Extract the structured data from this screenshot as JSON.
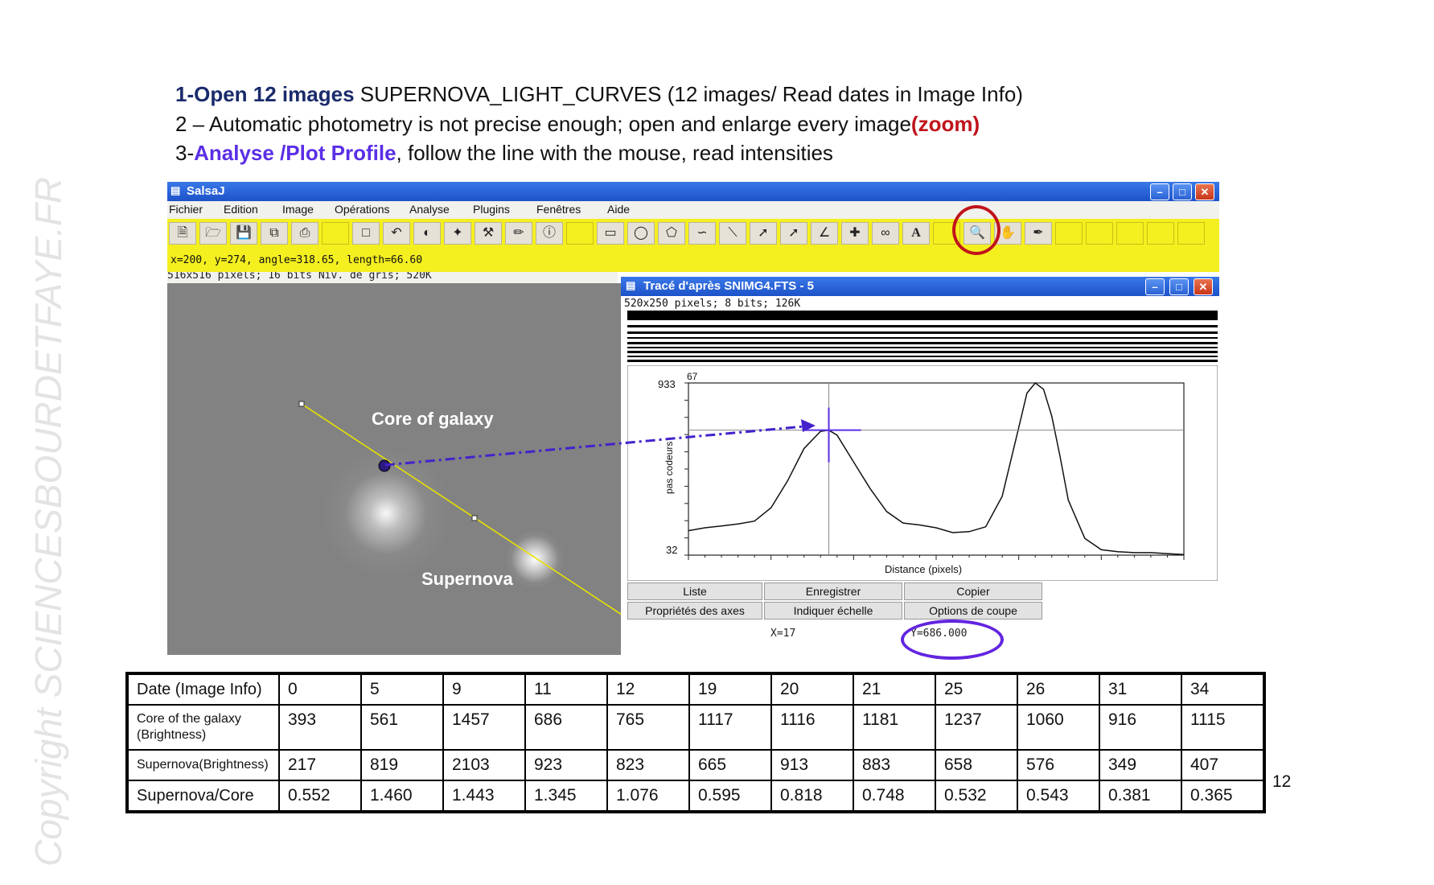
{
  "watermark": "Copyright SCIENCESBOURDETFAYE.FR",
  "instructions": {
    "line1_bold": "1-Open 12 images",
    "line1_rest": " SUPERNOVA_LIGHT_CURVES (12 images/ Read dates in Image Info)",
    "line2_rest": "2 – Automatic photometry is not precise enough; open and enlarge every image",
    "line2_red": "(zoom)",
    "line3_prefix": "3-",
    "line3_purple": "Analyse /Plot Profile",
    "line3_rest": ",  follow the line with the mouse, read intensities"
  },
  "salsaj": {
    "title": "SalsaJ",
    "menus": [
      "Fichier",
      "Edition",
      "Image",
      "Opérations",
      "Analyse",
      "Plugins",
      "Fenêtres",
      "Aide"
    ],
    "status": "x=200, y=274, angle=318.65, length=66.60",
    "image_info": "516x516 pixels; 16 bits Niv. de gris; 520K",
    "label_core": "Core of galaxy",
    "label_supernova": "Supernova"
  },
  "profile": {
    "title": "Tracé d'après SNIMG4.FTS - 5",
    "info": "520x250 pixels; 8 bits; 126K",
    "y_top": "933",
    "y_top_extra": "67",
    "y_bottom": "32",
    "ylabel": "pas codeurs",
    "xlabel": "Distance (pixels)",
    "buttons": [
      "Liste",
      "Enregistrer",
      "Copier",
      "Propriétés des axes",
      "Indiquer échelle",
      "Options de coupe"
    ],
    "x_readout": "X=17",
    "y_readout": "Y=686.000"
  },
  "chart_data": {
    "type": "line",
    "x": [
      0,
      2,
      4,
      6,
      8,
      10,
      12,
      14,
      16,
      17,
      18,
      20,
      22,
      24,
      26,
      28,
      30,
      32,
      34,
      36,
      38,
      40,
      41,
      42,
      43,
      44,
      45,
      46,
      48,
      50,
      52,
      54,
      56,
      58,
      60
    ],
    "values": [
      160,
      175,
      185,
      195,
      210,
      280,
      420,
      590,
      680,
      686,
      660,
      520,
      380,
      260,
      200,
      190,
      175,
      150,
      155,
      180,
      340,
      700,
      880,
      933,
      900,
      760,
      550,
      320,
      120,
      60,
      50,
      45,
      45,
      40,
      35
    ],
    "xlabel": "Distance (pixels)",
    "ylabel": "pas codeurs",
    "ylim": [
      32,
      933
    ]
  },
  "table": {
    "header_label": "Date (Image Info)",
    "dates": [
      "0",
      "5",
      "9",
      "11",
      "12",
      "19",
      "20",
      "21",
      "25",
      "26",
      "31",
      "34"
    ],
    "core_label_1": "Core of the galaxy",
    "core_label_2": "(Brightness)",
    "core": [
      "393",
      "561",
      "1457",
      "686",
      "765",
      "1117",
      "1116",
      "1181",
      "1237",
      "1060",
      "916",
      "1115"
    ],
    "sn_label": "Supernova(Brightness)",
    "supernova": [
      "217",
      "819",
      "2103",
      "923",
      "823",
      "665",
      "913",
      "883",
      "658",
      "576",
      "349",
      "407"
    ],
    "ratio_label": "Supernova/Core",
    "ratio": [
      "0.552",
      "1.460",
      "1.443",
      "1.345",
      "1.076",
      "0.595",
      "0.818",
      "0.748",
      "0.532",
      "0.543",
      "0.381",
      "0.365"
    ]
  },
  "page_number": "12"
}
